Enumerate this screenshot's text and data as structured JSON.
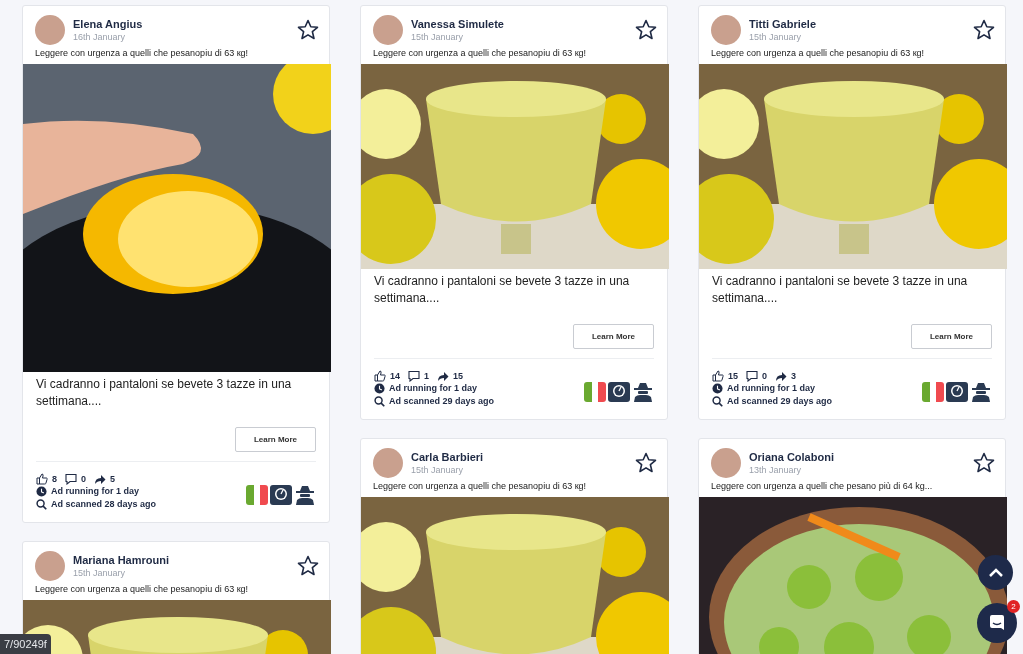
{
  "columns": [
    {
      "cards": [
        {
          "author": "Elena Angius",
          "date": "16th January",
          "caption": "Leggere con urgenza a quelli che pesanopiu di 63 кg!",
          "kind": "lemon-hand",
          "text": "Vi cadranno i pantaloni se bevete 3 tazze in una settimana....",
          "button": "Learn More",
          "likes": "8",
          "comments": "0",
          "shares": "5",
          "running": "Ad running for 1 day",
          "scanned": "Ad scanned 28 days ago",
          "starred": false
        },
        {
          "author": "Mariana Hamrouni",
          "date": "15th January",
          "caption": "Leggere con urgenza a quelli che pesanopiu di 63 кg!",
          "kind": "lemon-bowl",
          "starred": false
        }
      ]
    },
    {
      "cards": [
        {
          "author": "Vanessa Simulete",
          "date": "15th January",
          "caption": "Leggere con urgenza a quelli che pesanopiu di 63 кg!",
          "kind": "lemon-bowl",
          "text": "Vi cadranno i pantaloni se bevete 3 tazze in una settimana....",
          "button": "Learn More",
          "likes": "14",
          "comments": "1",
          "shares": "15",
          "running": "Ad running for 1 day",
          "scanned": "Ad scanned 29 days ago",
          "starred": false
        },
        {
          "author": "Carla Barbieri",
          "date": "15th January",
          "caption": "Leggere con urgenza a quelli che pesanopiu di 63 кg!",
          "kind": "lemon-bowl",
          "starred": false
        }
      ]
    },
    {
      "cards": [
        {
          "author": "Titti Gabriele",
          "date": "15th January",
          "caption": "Leggere con urgenza a quelli che pesanopiu di 63 кg!",
          "kind": "lemon-bowl",
          "text": "Vi cadranno i pantaloni se bevete 3 tazze in una settimana....",
          "button": "Learn More",
          "likes": "15",
          "comments": "0",
          "shares": "3",
          "running": "Ad running for 1 day",
          "scanned": "Ad scanned 29 days ago",
          "starred": false
        },
        {
          "author": "Oriana Colaboni",
          "date": "13th January",
          "caption": "Leggere con urgenza a quelli che pesano più di 64 kg...",
          "kind": "kiwi",
          "starred": false
        }
      ]
    }
  ],
  "chat": {
    "badge": "2"
  },
  "status_url": "7/90249f"
}
